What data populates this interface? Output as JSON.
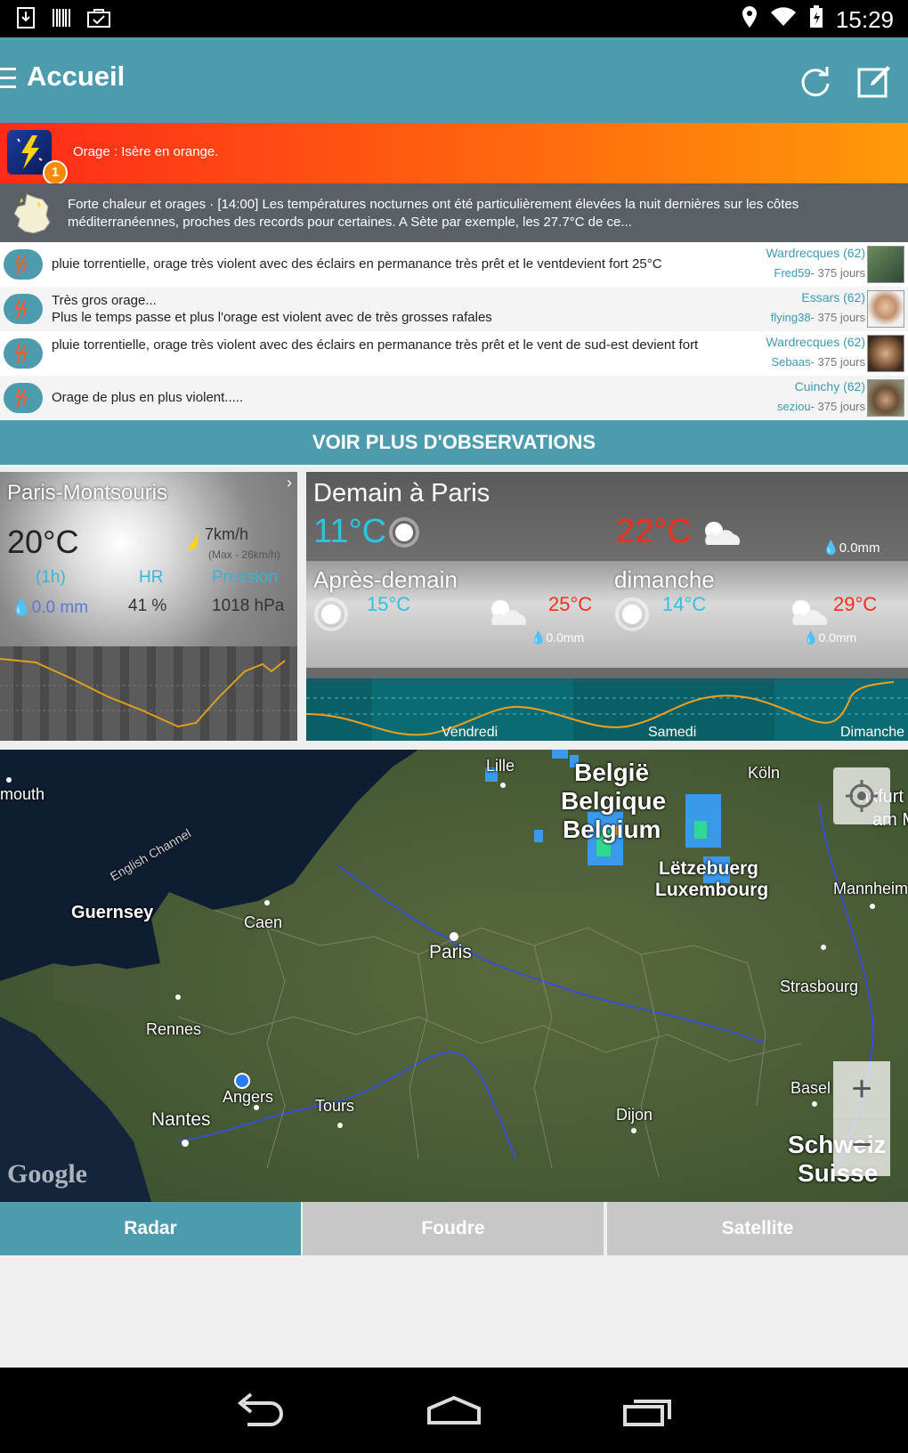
{
  "status_bar": {
    "time": "15:29"
  },
  "header": {
    "title": "Accueil"
  },
  "alert": {
    "text": "Orage : Isère en orange.",
    "badge": "1"
  },
  "news": {
    "text": "Forte chaleur et orages · [14:00] Les températures nocturnes ont été particulièrement élevées la nuit dernières sur les côtes méditerranéennes, proches des records pour certaines. A Sète par exemple, les 27.7°C de ce..."
  },
  "observations": [
    {
      "text": "pluie torrentielle, orage très violent avec des éclairs en permanance très prêt et le ventdevient fort 25°C",
      "location": "Wardrecques (62)",
      "user": "Fred59",
      "ago": "- 375 jours"
    },
    {
      "text": "Très gros orage...\nPlus le temps passe et plus l'orage est violent avec de très grosses rafales",
      "location": "Essars (62)",
      "user": "flying38",
      "ago": "- 375 jours"
    },
    {
      "text": "pluie torrentielle, orage très violent avec des éclairs en permanance très prêt et le vent de sud-est devient fort",
      "location": "Wardrecques (62)",
      "user": "Sebaas",
      "ago": "- 375 jours"
    },
    {
      "text": "Orage de plus en plus violent.....",
      "location": "Cuinchy (62)",
      "user": "seziou",
      "ago": "- 375 jours"
    }
  ],
  "more_button": "VOIR PLUS D'OBSERVATIONS",
  "station": {
    "name": "Paris-Montsouris",
    "temp": "20°C",
    "wind": "7km/h",
    "wind_max": "(Max - 26km/h)",
    "labels": {
      "rain": "(1h)",
      "humidity": "HR",
      "pressure": "Pression"
    },
    "values": {
      "rain": "0.0 mm",
      "humidity": "41 %",
      "pressure": "1018 hPa"
    }
  },
  "forecast": {
    "tomorrow": {
      "title": "Demain à Paris",
      "min": "11°C",
      "max": "22°C",
      "rain": "0.0mm"
    },
    "day2": {
      "title": "Après-demain",
      "min": "15°C",
      "max": "25°C",
      "rain": "0.0mm"
    },
    "day3": {
      "title": "dimanche",
      "min": "14°C",
      "max": "29°C",
      "rain": "0.0mm"
    },
    "chart_days": [
      "Vendredi",
      "Samedi",
      "Dimanche"
    ]
  },
  "map": {
    "labels": {
      "lille": "Lille",
      "belgie": "België",
      "belgique": "Belgique",
      "belgium": "Belgium",
      "koln": "Köln",
      "letzebuerg": "Lëtzebuerg",
      "luxembourg": "Luxembourg",
      "guernsey": "Guernsey",
      "caen": "Caen",
      "paris": "Paris",
      "rennes": "Rennes",
      "angers": "Angers",
      "tours": "Tours",
      "nantes": "Nantes",
      "dijon": "Dijon",
      "strasbourg": "Strasbourg",
      "mannheim": "Mannheim",
      "basel": "Basel",
      "schweiz": "Schweiz",
      "suisse": "Suisse",
      "english_channel": "English Channel",
      "plymouth": "mouth",
      "frankfurt": "nkfurt",
      "am_main": "am Main"
    },
    "google": "Google"
  },
  "tabs": [
    {
      "label": "Radar",
      "active": true
    },
    {
      "label": "Foudre",
      "active": false
    },
    {
      "label": "Satellite",
      "active": false
    }
  ],
  "colors": {
    "accent": "#4c9cae",
    "max_temp": "#ff2b1a",
    "min_temp": "#2ec3e0"
  }
}
